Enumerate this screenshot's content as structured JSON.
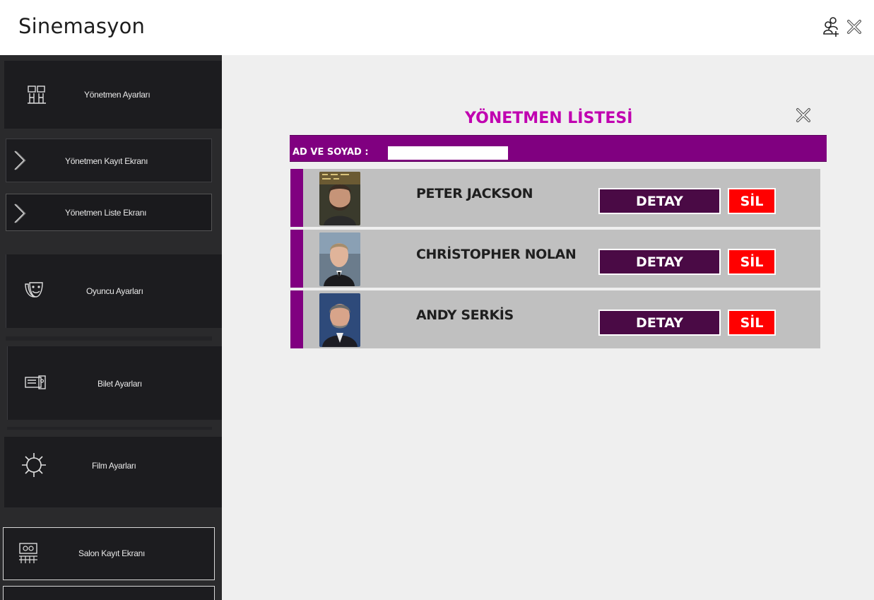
{
  "app": {
    "title": "Sinemasyon",
    "accent_color": "#800080",
    "title_color": "#c000b0",
    "delete_color": "#ff0000"
  },
  "titlebar": {
    "add_user_icon": "add-user-icon",
    "close_icon": "close-icon"
  },
  "sidebar": {
    "items": [
      {
        "label": "Yönetmen  Ayarları",
        "icon": "director-icon"
      },
      {
        "label": "Yönetmen Kayıt Ekranı",
        "icon": "chevron-right-icon"
      },
      {
        "label": "Yönetmen  Liste Ekranı",
        "icon": "chevron-right-icon"
      },
      {
        "label": "Oyuncu Ayarları",
        "icon": "theater-masks-icon"
      },
      {
        "label": "Bilet Ayarları",
        "icon": "ticket-icon"
      },
      {
        "label": "Film Ayarları",
        "icon": "gear-icon"
      },
      {
        "label": "Salon Kayıt Ekranı",
        "icon": "cinema-hall-icon"
      }
    ]
  },
  "main": {
    "list_title": "YÖNETMEN LİSTESİ",
    "search": {
      "label": "AD VE SOYAD :",
      "value": ""
    },
    "directors": [
      {
        "name": "PETER JACKSON",
        "detail_label": "DETAY",
        "delete_label": "SİL"
      },
      {
        "name": "CHRİSTOPHER NOLAN",
        "detail_label": "DETAY",
        "delete_label": "SİL"
      },
      {
        "name": "ANDY SERKİS",
        "detail_label": "DETAY",
        "delete_label": "SİL"
      }
    ]
  }
}
